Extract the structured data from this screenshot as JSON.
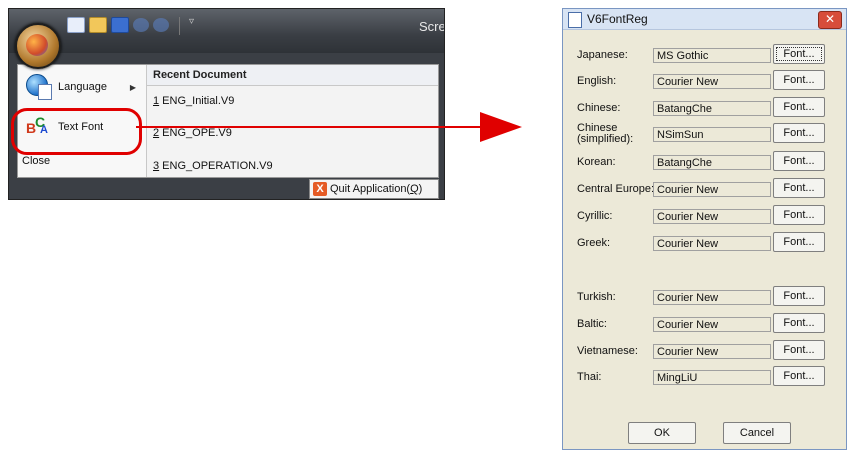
{
  "app": {
    "window_title": "Scre",
    "menu": {
      "language": "Language",
      "text_font": "Text Font",
      "close": "Close"
    },
    "recent": {
      "header": "Recent Document",
      "items": [
        {
          "num": "1",
          "name": " ENG_Initial.V9"
        },
        {
          "num": "2",
          "name": " ENG_OPE.V9"
        },
        {
          "num": "3",
          "name": " ENG_OPERATION.V9"
        }
      ]
    },
    "quit": {
      "label": "Quit Application(",
      "key": "Q",
      "end": ")"
    }
  },
  "dialog": {
    "title": "V6FontReg",
    "button_label": "Font...",
    "rows": [
      {
        "label": "Japanese:",
        "value": "MS Gothic"
      },
      {
        "label": "English:",
        "value": "Courier New"
      },
      {
        "label": "Chinese:",
        "value": "BatangChe"
      },
      {
        "label": "Chinese\n(simplified):",
        "value": "NSimSun"
      },
      {
        "label": "Korean:",
        "value": "BatangChe"
      },
      {
        "label": "Central Europe:",
        "value": "Courier New"
      },
      {
        "label": "Cyrillic:",
        "value": "Courier New"
      },
      {
        "label": "Greek:",
        "value": "Courier New"
      },
      {
        "label": "Turkish:",
        "value": "Courier New"
      },
      {
        "label": "Baltic:",
        "value": "Courier New"
      },
      {
        "label": "Vietnamese:",
        "value": "Courier New"
      },
      {
        "label": "Thai:",
        "value": "MingLiU"
      }
    ],
    "ok": "OK",
    "cancel": "Cancel"
  },
  "colors": {
    "highlight": "#e00000",
    "arrow": "#e00000"
  }
}
